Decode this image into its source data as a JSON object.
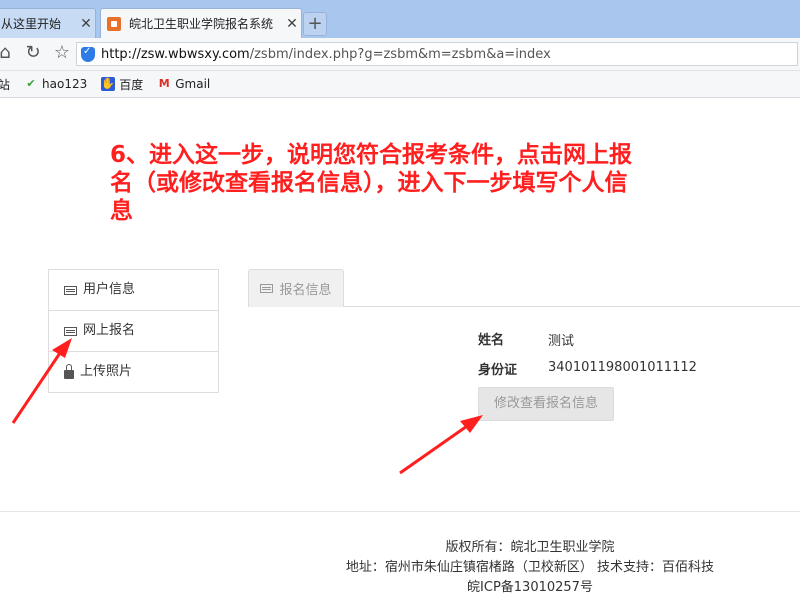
{
  "browser": {
    "tabs": [
      {
        "label": "从这里开始",
        "close": "✕"
      },
      {
        "label": "皖北卫生职业学院报名系统",
        "close": "✕"
      }
    ],
    "new_tab": "+",
    "url_host": "http://zsw.wbwsxy.com",
    "url_path": "/zsbm/index.php?g=zsbm&m=zsbm&a=index",
    "bookmarks": [
      {
        "label": "站",
        "icon": "site-icon"
      },
      {
        "label": "hao123",
        "icon": "hao123-icon"
      },
      {
        "label": "百度",
        "icon": "baidu-icon"
      },
      {
        "label": "Gmail",
        "icon": "gmail-icon"
      }
    ]
  },
  "instruction": "6、进入这一步，说明您符合报考条件，点击网上报名（或修改查看报名信息），进入下一步填写个人信息",
  "sidebar": {
    "items": [
      {
        "label": "用户信息",
        "icon": "id-card-icon"
      },
      {
        "label": "网上报名",
        "icon": "id-card-icon"
      },
      {
        "label": "上传照片",
        "icon": "lock-icon"
      }
    ]
  },
  "main": {
    "tab_label": "报名信息",
    "name_label": "姓名",
    "name_value": "测试",
    "id_label": "身份证",
    "id_value": "340101198001011112",
    "edit_button": "修改查看报名信息"
  },
  "footer": {
    "copyright": "版权所有：皖北卫生职业学院",
    "address": "地址：宿州市朱仙庄镇宿楮路（卫校新区） 技术支持：百佰科技",
    "icp": "皖ICP备13010257号"
  },
  "colors": {
    "annotation": "#ff1f1f",
    "tabbar": "#a9c6ee"
  }
}
